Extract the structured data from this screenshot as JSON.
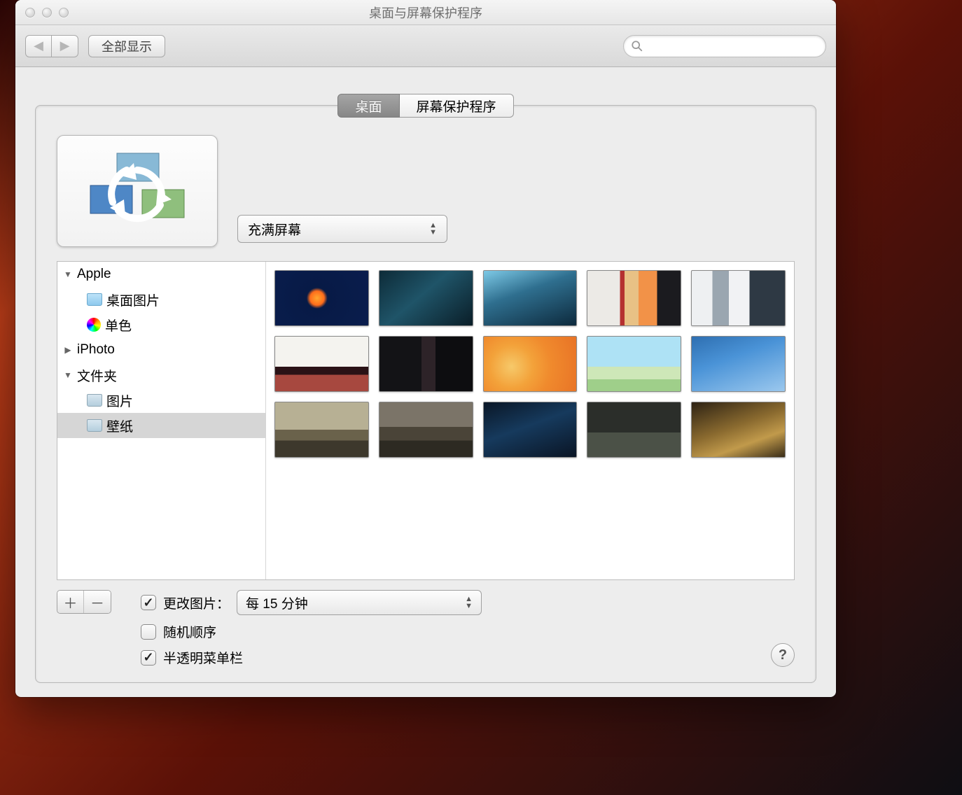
{
  "window_title": "桌面与屏幕保护程序",
  "toolbar": {
    "show_all": "全部显示",
    "search_placeholder": ""
  },
  "tabs": {
    "desktop": "桌面",
    "screensaver": "屏幕保护程序"
  },
  "fill_mode": "充满屏幕",
  "sidebar": {
    "apple": "Apple",
    "desktop_pictures": "桌面图片",
    "solid_colors": "单色",
    "iphoto": "iPhoto",
    "folders": "文件夹",
    "pictures": "图片",
    "wallpapers": "壁纸"
  },
  "thumbnails": [
    {
      "bg": "radial-gradient(circle at 45% 50%,#ffa62e 0,#ff6d1b 12%,#071a46 18%,#0a1d4d 100%)"
    },
    {
      "bg": "linear-gradient(140deg,#0d2b38,#1f5468 45%,#0a1e28)"
    },
    {
      "bg": "linear-gradient(160deg,#7dc9e6,#2f6f8f 40%,#0d2a3d)"
    },
    {
      "bg": "linear-gradient(90deg,#eceae6 0 35%,#b53030 35% 40%,#e8c185 40% 55%,#f29248 55% 75%,#1b1b1f 75%)"
    },
    {
      "bg": "linear-gradient(90deg,#eef0f2 0 22%,#9aa6b0 22% 40%,#f1f2f4 40% 62%,#2e3944 62%)"
    },
    {
      "bg": "linear-gradient(#f4f3ef 0 55%,#2a1216 55% 70%,#a7483f 70%)"
    },
    {
      "bg": "linear-gradient(90deg,#131316 0 45%,#2d2328 45% 60%,#0d0d10 60%)"
    },
    {
      "bg": "radial-gradient(circle at 30% 55%,#f6c96a,#f3a23a 30%,#f08a2d 55%,#e87326)"
    },
    {
      "bg": "linear-gradient(#aee2f5 0 55%,#cee7b8 55% 78%,#9fcf8a 78%)"
    },
    {
      "bg": "linear-gradient(160deg,#2e6fb1,#4a93d7 40%,#9bc8ee)"
    },
    {
      "bg": "linear-gradient(#b7b094 0 50%,#6a624b 50% 70%,#3d382c 70%)"
    },
    {
      "bg": "linear-gradient(#7b7468 0 45%,#4a4438 45% 70%,#2d2a22 70%)"
    },
    {
      "bg": "linear-gradient(160deg,#0a1727,#163a5d 45%,#0a1525)"
    },
    {
      "bg": "linear-gradient(#2b2e2a 0 55%,#4b5147 55% 100%)"
    },
    {
      "bg": "linear-gradient(160deg,#2e2314,#8a6a2f 45%,#c19a4b 70%,#3a2d18)"
    }
  ],
  "options": {
    "change_picture_label": "更改图片：",
    "interval": "每 15 分钟",
    "random_order": "随机顺序",
    "translucent_menubar": "半透明菜单栏"
  },
  "help": "?"
}
